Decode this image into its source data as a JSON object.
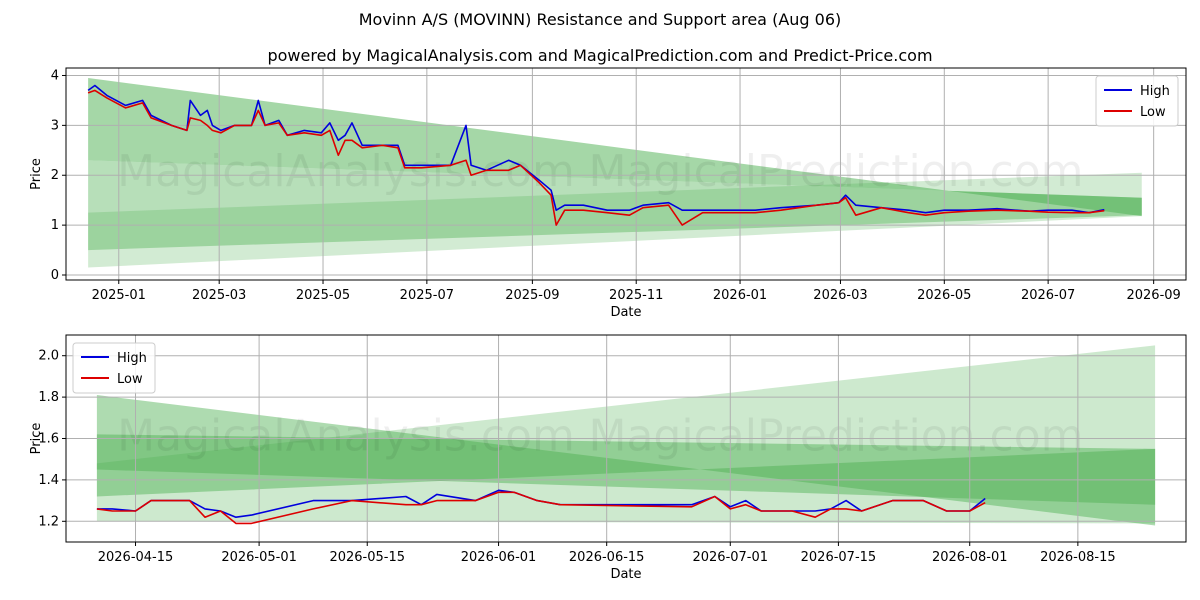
{
  "title": "Movinn A/S (MOVINN) Resistance and Support area (Aug 06)",
  "subtitle": "powered by MagicalAnalysis.com and MagicalPrediction.com and Predict-Price.com",
  "watermarks": [
    "MagicalAnalysis.com",
    "MagicalPrediction.com"
  ],
  "colors": {
    "high": "#0000dd",
    "low": "#dd0000",
    "band": "#4caf50"
  },
  "chart_data": [
    {
      "type": "line",
      "xlabel": "Date",
      "ylabel": "Price",
      "xlim": [
        "2024-12-01",
        "2026-09-20"
      ],
      "ylim": [
        -0.1,
        4.15
      ],
      "x_ticks": [
        "2025-01",
        "2025-03",
        "2025-05",
        "2025-07",
        "2025-09",
        "2025-11",
        "2026-01",
        "2026-03",
        "2026-05",
        "2026-07",
        "2026-09"
      ],
      "y_ticks": [
        0,
        1,
        2,
        3,
        4
      ],
      "grid": true,
      "legend": {
        "position": "top-right",
        "entries": [
          "High",
          "Low"
        ]
      },
      "bands": [
        {
          "x": [
            "2024-12-14",
            "2026-08-25"
          ],
          "upper": [
            3.95,
            1.18
          ],
          "lower": [
            2.3,
            1.55
          ],
          "opacity": 0.5
        },
        {
          "x": [
            "2024-12-14",
            "2026-08-25"
          ],
          "upper": [
            2.3,
            1.55
          ],
          "lower": [
            0.5,
            1.2
          ],
          "opacity": 0.4
        },
        {
          "x": [
            "2024-12-14",
            "2026-08-25"
          ],
          "upper": [
            1.25,
            2.05
          ],
          "lower": [
            0.15,
            1.18
          ],
          "opacity": 0.25
        }
      ],
      "series": [
        {
          "name": "High",
          "x": [
            "2024-12-14",
            "2024-12-18",
            "2024-12-25",
            "2025-01-05",
            "2025-01-15",
            "2025-01-20",
            "2025-02-01",
            "2025-02-10",
            "2025-02-12",
            "2025-02-18",
            "2025-02-22",
            "2025-02-25",
            "2025-03-02",
            "2025-03-10",
            "2025-03-20",
            "2025-03-24",
            "2025-03-28",
            "2025-04-05",
            "2025-04-10",
            "2025-04-20",
            "2025-04-30",
            "2025-05-05",
            "2025-05-10",
            "2025-05-14",
            "2025-05-18",
            "2025-05-24",
            "2025-06-05",
            "2025-06-14",
            "2025-06-18",
            "2025-06-28",
            "2025-07-15",
            "2025-07-24",
            "2025-07-27",
            "2025-08-05",
            "2025-08-18",
            "2025-08-25",
            "2025-09-05",
            "2025-09-12",
            "2025-09-15",
            "2025-09-20",
            "2025-10-01",
            "2025-10-15",
            "2025-10-28",
            "2025-11-05",
            "2025-11-20",
            "2025-11-28",
            "2025-12-10",
            "2025-12-25",
            "2026-01-10",
            "2026-01-25",
            "2026-02-15",
            "2026-02-28",
            "2026-03-04",
            "2026-03-10",
            "2026-03-25",
            "2026-04-10",
            "2026-04-20",
            "2026-05-01",
            "2026-05-15",
            "2026-06-01",
            "2026-06-20",
            "2026-07-01",
            "2026-07-15",
            "2026-07-25",
            "2026-08-03"
          ],
          "y": [
            3.7,
            3.8,
            3.6,
            3.4,
            3.5,
            3.2,
            3.0,
            2.9,
            3.5,
            3.2,
            3.3,
            3.0,
            2.9,
            3.0,
            3.0,
            3.5,
            3.0,
            3.1,
            2.8,
            2.9,
            2.85,
            3.05,
            2.7,
            2.8,
            3.05,
            2.6,
            2.6,
            2.6,
            2.2,
            2.2,
            2.2,
            3.0,
            2.2,
            2.1,
            2.3,
            2.2,
            1.9,
            1.7,
            1.3,
            1.4,
            1.4,
            1.3,
            1.3,
            1.4,
            1.45,
            1.3,
            1.3,
            1.3,
            1.3,
            1.35,
            1.4,
            1.45,
            1.6,
            1.4,
            1.35,
            1.3,
            1.25,
            1.3,
            1.3,
            1.33,
            1.28,
            1.3,
            1.3,
            1.25,
            1.31
          ]
        },
        {
          "name": "Low",
          "x": [
            "2024-12-14",
            "2024-12-18",
            "2024-12-25",
            "2025-01-05",
            "2025-01-15",
            "2025-01-20",
            "2025-02-01",
            "2025-02-10",
            "2025-02-12",
            "2025-02-18",
            "2025-02-22",
            "2025-02-25",
            "2025-03-02",
            "2025-03-10",
            "2025-03-20",
            "2025-03-24",
            "2025-03-28",
            "2025-04-05",
            "2025-04-10",
            "2025-04-20",
            "2025-04-30",
            "2025-05-05",
            "2025-05-10",
            "2025-05-14",
            "2025-05-18",
            "2025-05-24",
            "2025-06-05",
            "2025-06-14",
            "2025-06-18",
            "2025-06-28",
            "2025-07-15",
            "2025-07-24",
            "2025-07-27",
            "2025-08-05",
            "2025-08-18",
            "2025-08-25",
            "2025-09-05",
            "2025-09-12",
            "2025-09-15",
            "2025-09-20",
            "2025-10-01",
            "2025-10-15",
            "2025-10-28",
            "2025-11-05",
            "2025-11-20",
            "2025-11-28",
            "2025-12-10",
            "2025-12-25",
            "2026-01-10",
            "2026-01-25",
            "2026-02-15",
            "2026-02-28",
            "2026-03-04",
            "2026-03-10",
            "2026-03-25",
            "2026-04-10",
            "2026-04-20",
            "2026-05-01",
            "2026-05-15",
            "2026-06-01",
            "2026-06-20",
            "2026-07-01",
            "2026-07-15",
            "2026-07-25",
            "2026-08-03"
          ],
          "y": [
            3.65,
            3.7,
            3.55,
            3.35,
            3.45,
            3.15,
            3.0,
            2.9,
            3.15,
            3.1,
            3.0,
            2.9,
            2.85,
            3.0,
            3.0,
            3.3,
            3.0,
            3.05,
            2.8,
            2.85,
            2.8,
            2.9,
            2.4,
            2.7,
            2.7,
            2.55,
            2.6,
            2.55,
            2.15,
            2.15,
            2.2,
            2.3,
            2.0,
            2.1,
            2.1,
            2.2,
            1.85,
            1.6,
            1.0,
            1.3,
            1.3,
            1.25,
            1.2,
            1.35,
            1.4,
            1.0,
            1.25,
            1.25,
            1.25,
            1.3,
            1.4,
            1.45,
            1.55,
            1.2,
            1.35,
            1.25,
            1.2,
            1.25,
            1.28,
            1.3,
            1.28,
            1.26,
            1.25,
            1.25,
            1.29
          ]
        }
      ]
    },
    {
      "type": "line",
      "xlabel": "Date",
      "ylabel": "Price",
      "xlim": [
        "2026-04-06",
        "2026-08-29"
      ],
      "ylim": [
        1.1,
        2.1
      ],
      "x_ticks": [
        "2026-04-15",
        "2026-05-01",
        "2026-05-15",
        "2026-06-01",
        "2026-06-15",
        "2026-07-01",
        "2026-07-15",
        "2026-08-01",
        "2026-08-15"
      ],
      "y_ticks": [
        "1.2",
        "1.4",
        "1.6",
        "1.8",
        "2.0"
      ],
      "grid": true,
      "legend": {
        "position": "top-left",
        "entries": [
          "High",
          "Low"
        ]
      },
      "bands": [
        {
          "x": [
            "2026-04-10",
            "2026-08-25"
          ],
          "upper": [
            1.81,
            1.18
          ],
          "lower": [
            1.32,
            1.55
          ],
          "opacity": 0.45
        },
        {
          "x": [
            "2026-04-10",
            "2026-08-25"
          ],
          "upper": [
            1.62,
            1.55
          ],
          "lower": [
            1.45,
            1.28
          ],
          "opacity": 0.45
        },
        {
          "x": [
            "2026-04-10",
            "2026-08-25"
          ],
          "upper": [
            1.48,
            2.05
          ],
          "lower": [
            1.2,
            1.19
          ],
          "opacity": 0.28
        }
      ],
      "series": [
        {
          "name": "High",
          "x": [
            "2026-04-10",
            "2026-04-12",
            "2026-04-15",
            "2026-04-17",
            "2026-04-22",
            "2026-04-24",
            "2026-04-26",
            "2026-04-28",
            "2026-04-30",
            "2026-05-08",
            "2026-05-13",
            "2026-05-20",
            "2026-05-22",
            "2026-05-24",
            "2026-05-29",
            "2026-06-01",
            "2026-06-03",
            "2026-06-06",
            "2026-06-09",
            "2026-06-26",
            "2026-06-29",
            "2026-07-01",
            "2026-07-03",
            "2026-07-05",
            "2026-07-09",
            "2026-07-12",
            "2026-07-14",
            "2026-07-16",
            "2026-07-18",
            "2026-07-22",
            "2026-07-26",
            "2026-07-29",
            "2026-08-01",
            "2026-08-03"
          ],
          "y": [
            1.26,
            1.26,
            1.25,
            1.3,
            1.3,
            1.26,
            1.25,
            1.22,
            1.23,
            1.3,
            1.3,
            1.32,
            1.28,
            1.33,
            1.3,
            1.35,
            1.34,
            1.3,
            1.28,
            1.28,
            1.32,
            1.27,
            1.3,
            1.25,
            1.25,
            1.25,
            1.26,
            1.3,
            1.25,
            1.3,
            1.3,
            1.25,
            1.25,
            1.31
          ]
        },
        {
          "name": "Low",
          "x": [
            "2026-04-10",
            "2026-04-12",
            "2026-04-15",
            "2026-04-17",
            "2026-04-22",
            "2026-04-24",
            "2026-04-26",
            "2026-04-28",
            "2026-04-30",
            "2026-05-08",
            "2026-05-13",
            "2026-05-20",
            "2026-05-22",
            "2026-05-24",
            "2026-05-29",
            "2026-06-01",
            "2026-06-03",
            "2026-06-06",
            "2026-06-09",
            "2026-06-26",
            "2026-06-29",
            "2026-07-01",
            "2026-07-03",
            "2026-07-05",
            "2026-07-09",
            "2026-07-12",
            "2026-07-14",
            "2026-07-16",
            "2026-07-18",
            "2026-07-22",
            "2026-07-26",
            "2026-07-29",
            "2026-08-01",
            "2026-08-03"
          ],
          "y": [
            1.26,
            1.25,
            1.25,
            1.3,
            1.3,
            1.22,
            1.25,
            1.19,
            1.19,
            1.26,
            1.3,
            1.28,
            1.28,
            1.3,
            1.3,
            1.34,
            1.34,
            1.3,
            1.28,
            1.27,
            1.32,
            1.26,
            1.28,
            1.25,
            1.25,
            1.22,
            1.26,
            1.26,
            1.25,
            1.3,
            1.3,
            1.25,
            1.25,
            1.29
          ]
        }
      ]
    }
  ]
}
